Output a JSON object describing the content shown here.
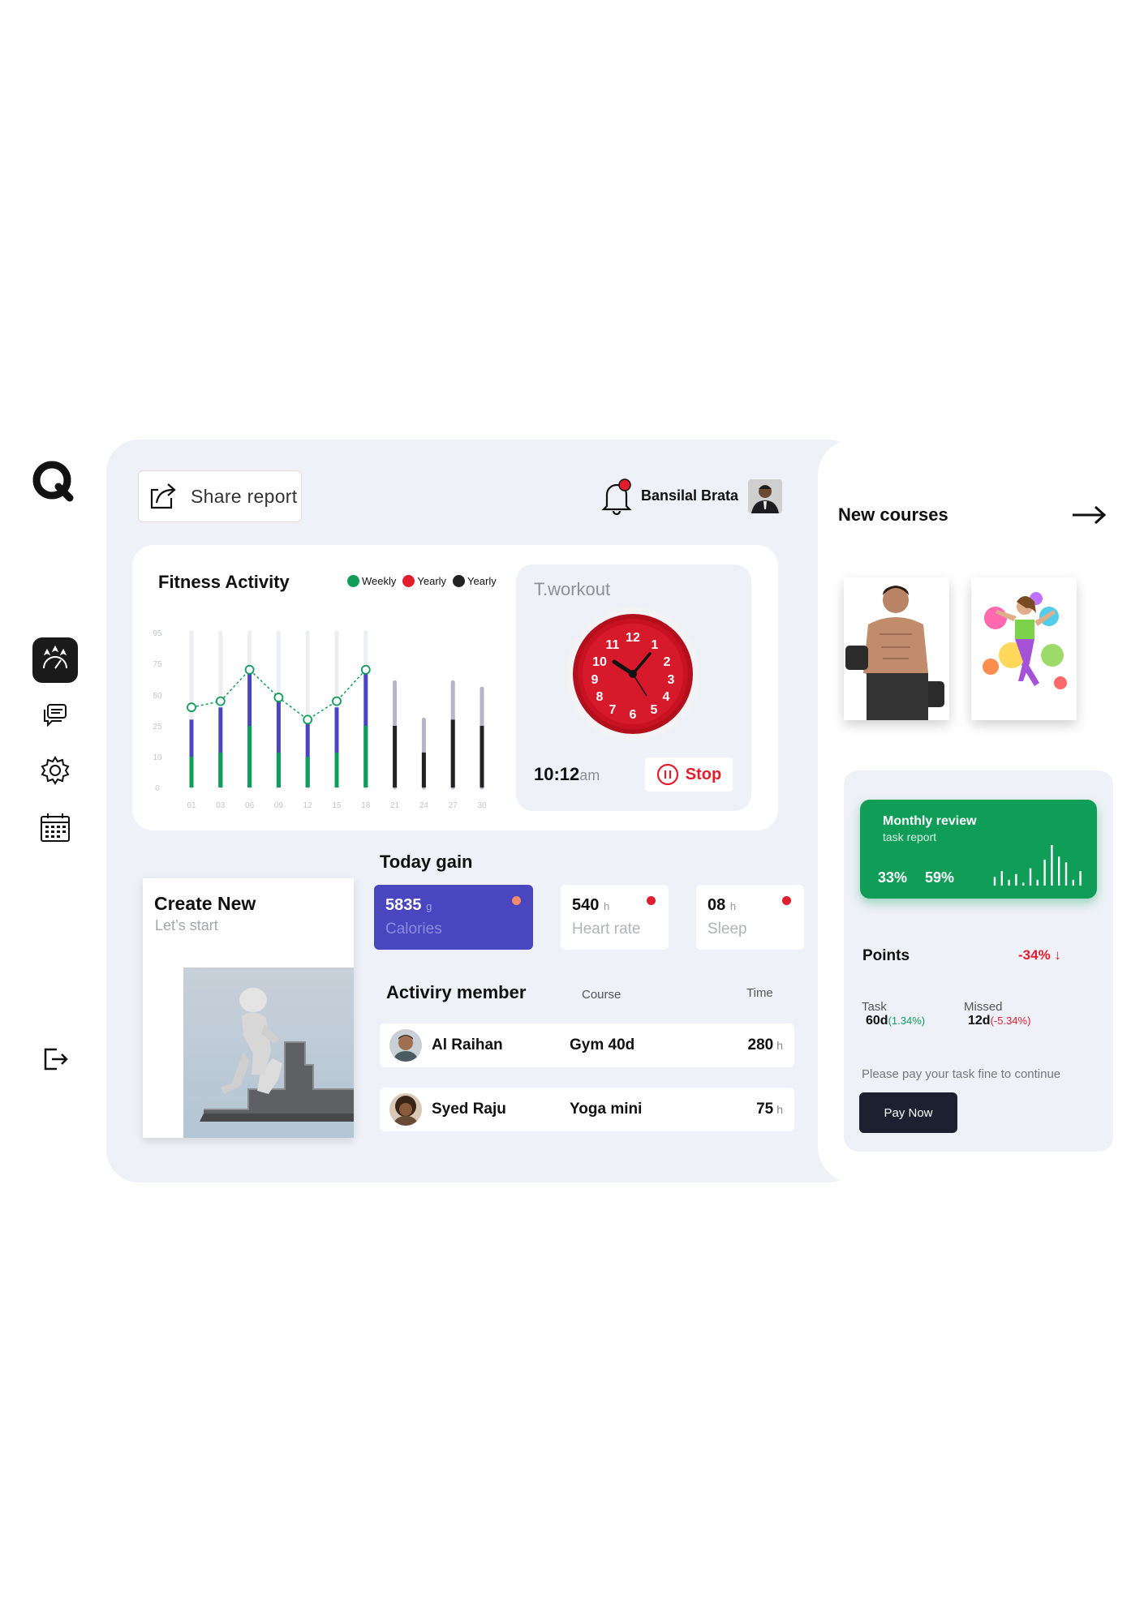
{
  "header": {
    "share_label": "Share report",
    "user_name": "Bansilal Brata"
  },
  "fitness": {
    "title": "Fitness Activity",
    "legend": [
      {
        "label": "Weekly",
        "color": "#0f9d58"
      },
      {
        "label": "Yearly",
        "color": "#e11d2e"
      },
      {
        "label": "Yearly",
        "color": "#222222"
      }
    ]
  },
  "chart_data": {
    "type": "bar",
    "title": "Fitness Activity",
    "categories": [
      "01",
      "03",
      "06",
      "09",
      "12",
      "15",
      "18",
      "21",
      "24",
      "27",
      "30"
    ],
    "y_ticks": [
      "95",
      "75",
      "50",
      "25",
      "10",
      "0"
    ],
    "series": [
      {
        "name": "Weekly",
        "color": "#0f9d58",
        "values": [
          10,
          12,
          25,
          12,
          10,
          12,
          25,
          null,
          null,
          null,
          null
        ]
      },
      {
        "name": "Yearly",
        "color": "#4a46c0",
        "values": [
          30,
          40,
          70,
          50,
          27,
          40,
          70,
          null,
          null,
          null,
          null
        ]
      },
      {
        "name": "Yearly",
        "color": "#222222",
        "values": [
          null,
          null,
          null,
          null,
          null,
          null,
          null,
          25,
          12,
          30,
          25
        ]
      }
    ],
    "background_values": [
      95,
      95,
      95,
      95,
      95,
      95,
      95,
      60,
      30,
      60,
      55
    ],
    "trend_line": [
      40,
      45,
      70,
      48,
      30,
      45,
      70
    ]
  },
  "workout": {
    "title": "T.workout",
    "time": "10:12",
    "ampm": "am",
    "stop_label": "Stop"
  },
  "today": {
    "title": "Today gain",
    "create_title": "Create New",
    "create_sub": "Let’s start",
    "calories": {
      "value": "5835",
      "unit": "g",
      "label": "Calories"
    },
    "heart": {
      "value": "540",
      "unit": "h",
      "label": "Heart rate"
    },
    "sleep": {
      "value": "08",
      "unit": "h",
      "label": "Sleep"
    }
  },
  "activity": {
    "title": "Activiry member",
    "col_course": "Course",
    "col_time": "Time",
    "members": [
      {
        "name": "Al Raihan",
        "course": "Gym 40d",
        "time": "280",
        "unit": "h"
      },
      {
        "name": "Syed Raju",
        "course": "Yoga mini",
        "time": "75",
        "unit": "h"
      }
    ]
  },
  "courses": {
    "title": "New courses"
  },
  "review": {
    "title": "Monthly review",
    "subtitle": "task report",
    "pct1": "33%",
    "pct2": "59%",
    "bars": [
      3,
      5,
      2,
      4,
      1,
      6,
      2,
      9,
      14,
      10,
      8,
      2,
      5
    ]
  },
  "points": {
    "label": "Points",
    "value": "-34% ↓",
    "task_label": "Task",
    "task_value": "60d",
    "task_pct": "(1.34%)",
    "missed_label": "Missed",
    "missed_value": "12d",
    "missed_pct": "(-5.34%)",
    "pay_note": "Please pay your task fine to continue",
    "pay_label": "Pay Now"
  }
}
